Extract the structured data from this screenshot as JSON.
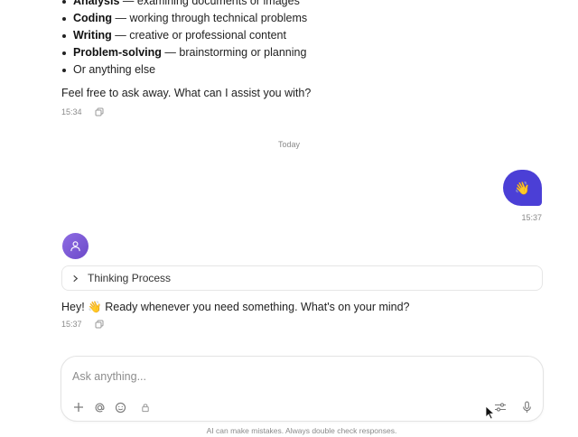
{
  "assistant_intro": {
    "bullets": [
      {
        "title": "Analysis",
        "desc": " — examining documents or images"
      },
      {
        "title": "Coding",
        "desc": " — working through technical problems"
      },
      {
        "title": "Writing",
        "desc": " — creative or professional content"
      },
      {
        "title": "Problem-solving",
        "desc": " — brainstorming or planning"
      },
      {
        "title": "",
        "desc": "Or anything else"
      }
    ],
    "closing": "Feel free to ask away. What can I assist you with?",
    "time": "15:34"
  },
  "divider": {
    "label": "Today"
  },
  "user_message": {
    "text": "👋",
    "time": "15:37"
  },
  "assistant_reply": {
    "thinking_label": "Thinking Process",
    "text": "Hey! 👋 Ready whenever you need something. What's on your mind?",
    "time": "15:37"
  },
  "composer": {
    "placeholder": "Ask anything..."
  },
  "footer": {
    "disclaimer": "AI can make mistakes. Always double check responses."
  },
  "colors": {
    "accent": "#4b3fd6",
    "avatar": "#7d5bd8"
  },
  "icons": [
    "copy-icon",
    "user-icon",
    "chevron-right-icon",
    "plus-icon",
    "at-icon",
    "emoji-icon",
    "lock-icon",
    "settings-sliders-icon",
    "microphone-icon"
  ]
}
